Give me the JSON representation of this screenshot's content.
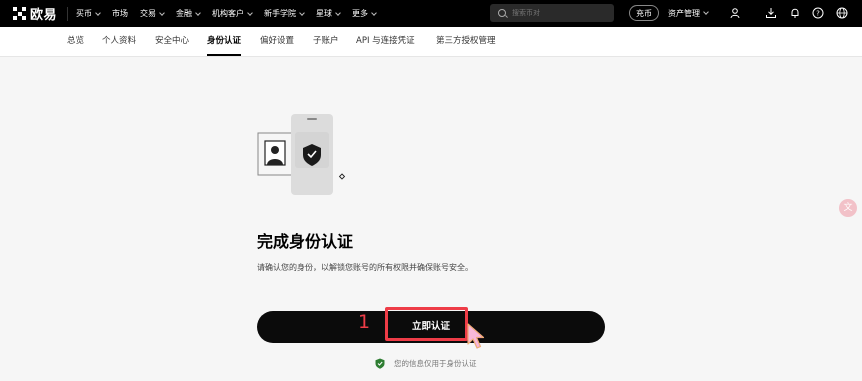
{
  "brand": {
    "name": "欧易"
  },
  "topnav": {
    "items": [
      {
        "label": "买币",
        "dropdown": true
      },
      {
        "label": "市场",
        "dropdown": false
      },
      {
        "label": "交易",
        "dropdown": true
      },
      {
        "label": "金融",
        "dropdown": true
      },
      {
        "label": "机构客户",
        "dropdown": true
      },
      {
        "label": "新手学院",
        "dropdown": true
      },
      {
        "label": "星球",
        "dropdown": true
      },
      {
        "label": "更多",
        "dropdown": true
      }
    ],
    "search_placeholder": "搜索币对",
    "deposit_label": "充币",
    "assets_label": "资产管理",
    "icons": [
      "user-icon",
      "download-icon",
      "bell-icon",
      "help-icon",
      "globe-icon"
    ]
  },
  "subnav": {
    "items": [
      "总览",
      "个人资料",
      "安全中心",
      "身份认证",
      "偏好设置",
      "子账户",
      "API 与连接凭证",
      "第三方授权管理"
    ],
    "active": "身份认证"
  },
  "main": {
    "title": "完成身份认证",
    "description": "请确认您的身份，以解锁您账号的所有权限并确保账号安全。",
    "cta_label": "立即认证",
    "privacy_note": "您的信息仅用于身份认证"
  },
  "annotation": {
    "step_number": "1",
    "color": "#ee3c47"
  },
  "side_badge": {
    "label": "文"
  },
  "colors": {
    "topbar": "#000000",
    "cta": "#0b0b0b",
    "shield_green": "#2e7d32",
    "highlight": "#ee3c47"
  }
}
